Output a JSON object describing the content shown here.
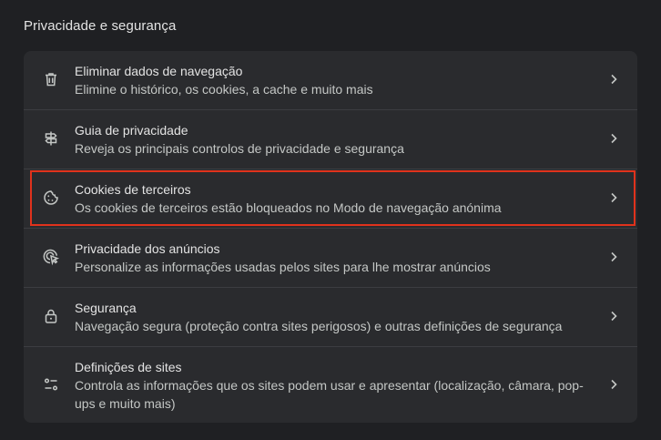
{
  "section": {
    "title": "Privacidade e segurança"
  },
  "rows": [
    {
      "icon": "trash-icon",
      "title": "Eliminar dados de navegação",
      "desc": "Elimine o histórico, os cookies, a cache e muito mais"
    },
    {
      "icon": "signpost-icon",
      "title": "Guia de privacidade",
      "desc": "Reveja os principais controlos de privacidade e segurança"
    },
    {
      "icon": "cookie-icon",
      "title": "Cookies de terceiros",
      "desc": "Os cookies de terceiros estão bloqueados no Modo de navegação anónima"
    },
    {
      "icon": "ad-privacy-icon",
      "title": "Privacidade dos anúncios",
      "desc": "Personalize as informações usadas pelos sites para lhe mostrar anúncios"
    },
    {
      "icon": "lock-icon",
      "title": "Segurança",
      "desc": "Navegação segura (proteção contra sites perigosos) e outras definições de segurança"
    },
    {
      "icon": "tune-icon",
      "title": "Definições de sites",
      "desc": "Controla as informações que os sites podem usar e apresentar (localização, câmara, pop-ups e muito mais)"
    }
  ],
  "colors": {
    "background": "#1f2023",
    "card": "#2a2b2e",
    "highlight": "#e0321c"
  }
}
